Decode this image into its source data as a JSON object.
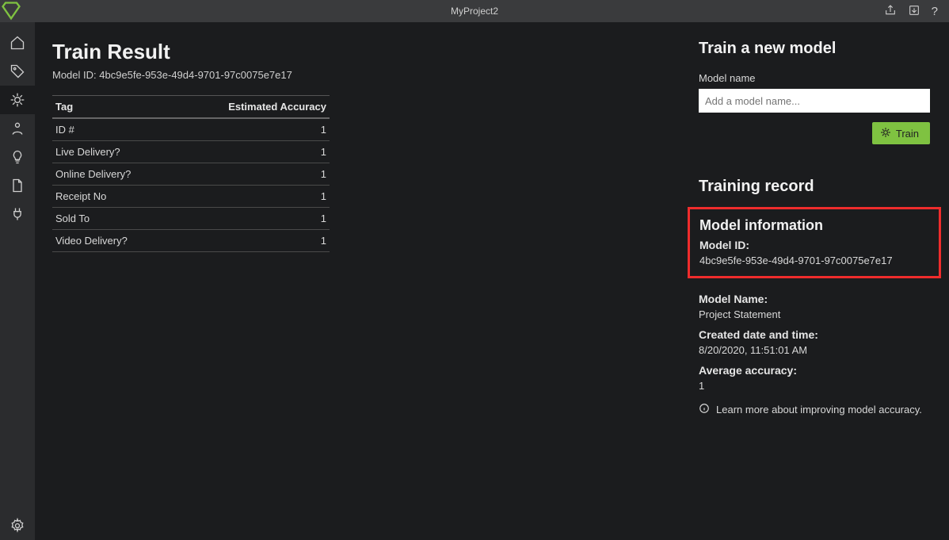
{
  "titlebar": {
    "title": "MyProject2"
  },
  "sidebar": {
    "items": [
      {
        "name": "home-icon"
      },
      {
        "name": "tag-icon"
      },
      {
        "name": "train-icon",
        "active": true
      },
      {
        "name": "person-icon"
      },
      {
        "name": "lightbulb-icon"
      },
      {
        "name": "file-icon"
      },
      {
        "name": "plug-icon"
      }
    ],
    "bottom": {
      "name": "settings-icon"
    }
  },
  "main": {
    "heading": "Train Result",
    "sub_prefix": "Model ID: ",
    "model_id": "4bc9e5fe-953e-49d4-9701-97c0075e7e17",
    "table": {
      "col_tag": "Tag",
      "col_acc": "Estimated Accuracy",
      "rows": [
        {
          "tag": "ID #",
          "acc": "1"
        },
        {
          "tag": "Live Delivery?",
          "acc": "1"
        },
        {
          "tag": "Online Delivery?",
          "acc": "1"
        },
        {
          "tag": "Receipt No",
          "acc": "1"
        },
        {
          "tag": "Sold To",
          "acc": "1"
        },
        {
          "tag": "Video Delivery?",
          "acc": "1"
        }
      ]
    }
  },
  "panel": {
    "heading": "Train a new model",
    "model_name_label": "Model name",
    "model_name_placeholder": "Add a model name...",
    "train_button": "Train",
    "record_heading": "Training record",
    "info": {
      "heading": "Model information",
      "model_id_label": "Model ID:",
      "model_id": "4bc9e5fe-953e-49d4-9701-97c0075e7e17",
      "model_name_label": "Model Name:",
      "model_name": "Project Statement",
      "created_label": "Created date and time:",
      "created": "8/20/2020, 11:51:01 AM",
      "avg_acc_label": "Average accuracy:",
      "avg_acc": "1",
      "learn_more": "Learn more about improving model accuracy."
    }
  }
}
